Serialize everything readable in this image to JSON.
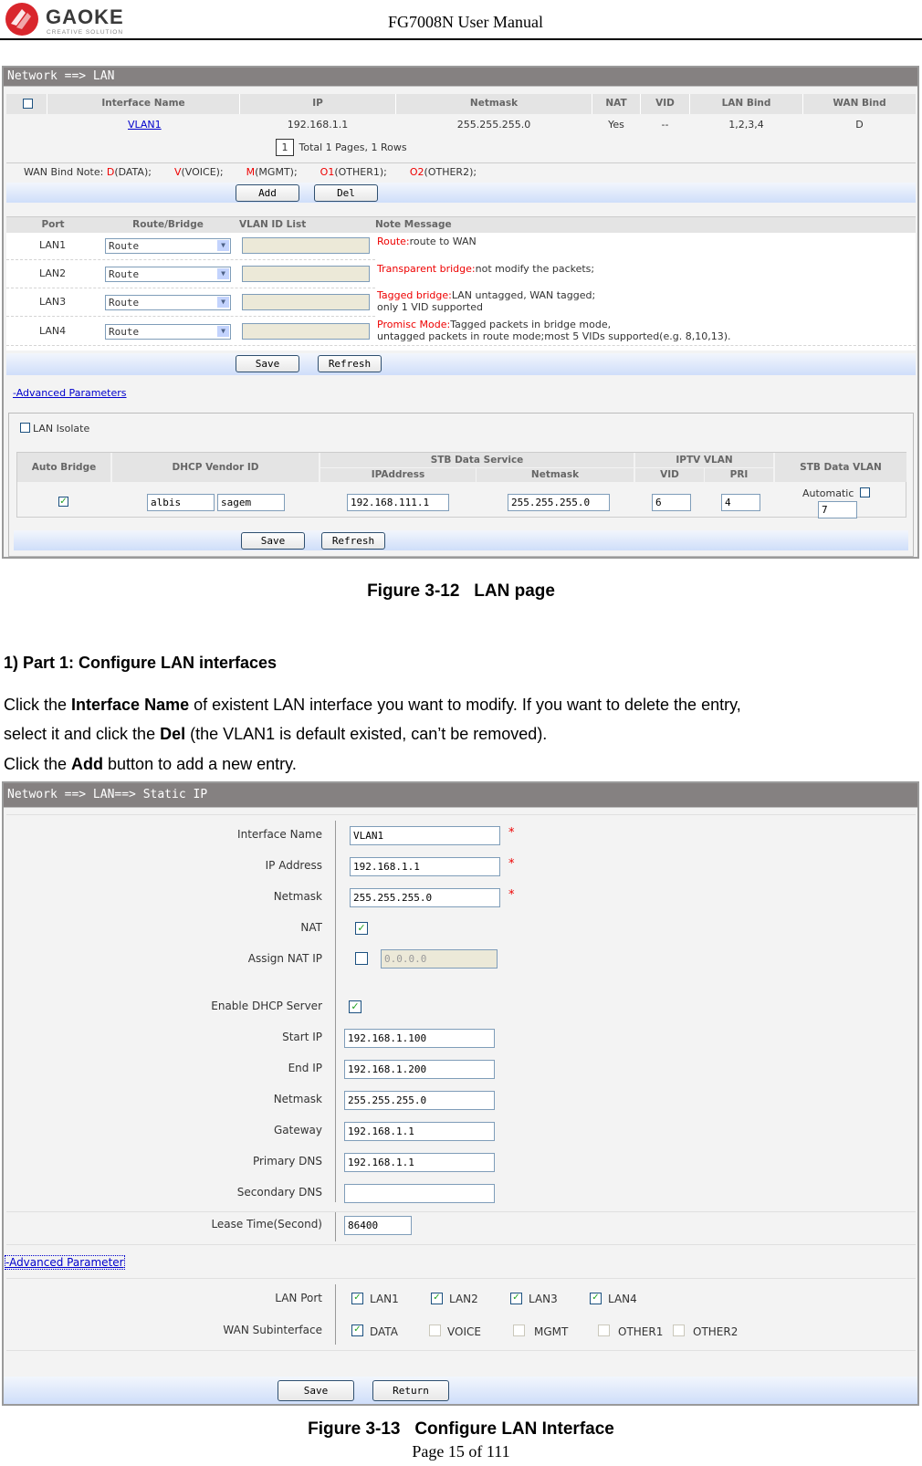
{
  "header": {
    "logo_text": "GAOKE",
    "logo_sub": "CREATIVE SOLUTION",
    "title": "FG7008N User Manual"
  },
  "fig12": {
    "breadcrumb": "Network ==> LAN",
    "table": {
      "headers": [
        "Interface Name",
        "IP",
        "Netmask",
        "NAT",
        "VID",
        "LAN Bind",
        "WAN Bind"
      ],
      "rows": [
        {
          "interface": "VLAN1",
          "ip": "192.168.1.1",
          "netmask": "255.255.255.0",
          "nat": "Yes",
          "vid": "--",
          "lan_bind": "1,2,3,4",
          "wan_bind": "D"
        }
      ]
    },
    "pager": {
      "page": "1",
      "summary": "Total 1 Pages, 1 Rows"
    },
    "wan_note": {
      "label": "WAN Bind Note:",
      "items": [
        {
          "key": "D",
          "text": "(DATA);"
        },
        {
          "key": "V",
          "text": "(VOICE);"
        },
        {
          "key": "M",
          "text": "(MGMT);"
        },
        {
          "key": "O1",
          "text": "(OTHER1);"
        },
        {
          "key": "O2",
          "text": "(OTHER2);"
        }
      ]
    },
    "add_label": "Add",
    "del_label": "Del",
    "ports": {
      "headers": [
        "Port",
        "Route/Bridge",
        "VLAN ID List",
        "Note Message"
      ],
      "rows": [
        {
          "port": "LAN1",
          "mode": "Route",
          "vlan_list": ""
        },
        {
          "port": "LAN2",
          "mode": "Route",
          "vlan_list": ""
        },
        {
          "port": "LAN3",
          "mode": "Route",
          "vlan_list": ""
        },
        {
          "port": "LAN4",
          "mode": "Route",
          "vlan_list": ""
        }
      ],
      "notes": [
        {
          "key": "Route:",
          "text": "route to WAN",
          "text2": ""
        },
        {
          "key": "Transparent bridge:",
          "text": "not modify the packets;",
          "text2": ""
        },
        {
          "key": "Tagged bridge:",
          "text": "LAN untagged, WAN tagged;",
          "text2": "only 1 VID supported"
        },
        {
          "key": "Promisc Mode:",
          "text": "Tagged packets in bridge mode,",
          "text2": "untagged packets in route mode;most 5 VIDs supported(e.g. 8,10,13)."
        }
      ]
    },
    "save_label": "Save",
    "refresh_label": "Refresh",
    "advanced_link": "-Advanced Parameters",
    "advanced": {
      "lan_isolate_label": "LAN Isolate",
      "lan_isolate_checked": false,
      "headers": {
        "auto_bridge": "Auto Bridge",
        "dhcp_vendor_id": "DHCP Vendor ID",
        "stb_data_service": "STB Data Service",
        "ip_address": "IPAddress",
        "netmask": "Netmask",
        "iptv_vlan": "IPTV VLAN",
        "vid": "VID",
        "pri": "PRI",
        "stb_data_vlan": "STB Data VLAN"
      },
      "auto_bridge_checked": true,
      "vendor_id_1": "albis",
      "vendor_id_2": "sagem",
      "stb_ip": "192.168.111.1",
      "stb_netmask": "255.255.255.0",
      "iptv_vid": "6",
      "iptv_pri": "4",
      "automatic_label": "Automatic",
      "automatic_checked": false,
      "stb_data_vlan": "7",
      "save_label": "Save",
      "refresh_label": "Refresh"
    },
    "caption": "Figure 3-12   LAN page"
  },
  "doc": {
    "heading": "1) Part 1: Configure LAN interfaces",
    "p1_a": "Click the ",
    "p1_b": "Interface Name",
    "p1_c": " of existent LAN interface you want to modify. If you want to delete the entry,",
    "p2_a": "select it and click the ",
    "p2_b": "Del",
    "p2_c": " (the VLAN1 is default existed, can’t be removed).",
    "p3_a": "Click the ",
    "p3_b": "Add",
    "p3_c": " button to add a new entry."
  },
  "fig13": {
    "breadcrumb": "Network ==> LAN==> Static IP",
    "fields": {
      "interface_name": {
        "label": "Interface Name",
        "value": "VLAN1",
        "required": "*"
      },
      "ip_address": {
        "label": "IP Address",
        "value": "192.168.1.1",
        "required": "*"
      },
      "netmask": {
        "label": "Netmask",
        "value": "255.255.255.0",
        "required": "*"
      },
      "nat": {
        "label": "NAT",
        "checked": true
      },
      "assign_nat_ip": {
        "label": "Assign NAT IP",
        "checked": false,
        "value": "0.0.0.0"
      },
      "enable_dhcp": {
        "label": "Enable DHCP Server",
        "checked": true
      },
      "start_ip": {
        "label": "Start IP",
        "value": "192.168.1.100"
      },
      "end_ip": {
        "label": "End IP",
        "value": "192.168.1.200"
      },
      "dhcp_netmask": {
        "label": "Netmask",
        "value": "255.255.255.0"
      },
      "gateway": {
        "label": "Gateway",
        "value": "192.168.1.1"
      },
      "primary_dns": {
        "label": "Primary DNS",
        "value": "192.168.1.1"
      },
      "secondary_dns": {
        "label": "Secondary DNS",
        "value": ""
      },
      "lease_time": {
        "label": "Lease Time(Second)",
        "value": "86400"
      }
    },
    "advanced_link": "-Advanced Parameter",
    "lan_port_label": "LAN Port",
    "lan_ports": [
      {
        "label": "LAN1",
        "checked": true
      },
      {
        "label": "LAN2",
        "checked": true
      },
      {
        "label": "LAN3",
        "checked": true
      },
      {
        "label": "LAN4",
        "checked": true
      }
    ],
    "wan_sub_label": "WAN Subinterface",
    "wan_subs": [
      {
        "label": "DATA",
        "checked": true
      },
      {
        "label": "VOICE",
        "checked": false
      },
      {
        "label": "MGMT",
        "checked": false
      },
      {
        "label": "OTHER1",
        "checked": false
      },
      {
        "label": "OTHER2",
        "checked": false
      }
    ],
    "save_label": "Save",
    "return_label": "Return",
    "caption": "Figure 3-13   Configure LAN Interface"
  },
  "footer": {
    "page": "Page 15 of 111"
  },
  "colors": {
    "accent_red": "#e00000",
    "link_blue": "#0000cc",
    "check_green": "#21a121",
    "titlebar_gray": "#858181"
  }
}
